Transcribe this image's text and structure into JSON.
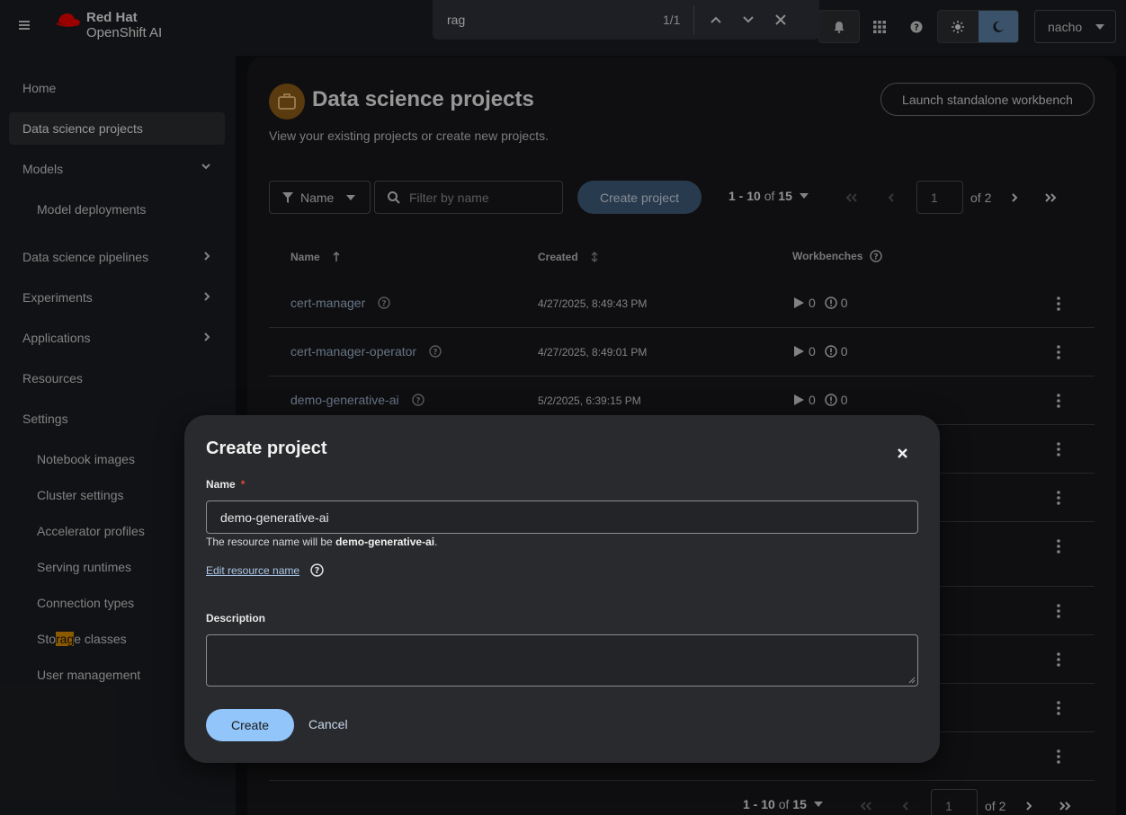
{
  "masthead": {
    "brand": "Red Hat",
    "product": "OpenShift AI",
    "user": "nacho"
  },
  "findbar": {
    "query": "rag",
    "count": "1/1"
  },
  "sidebar": {
    "items": [
      {
        "label": "Home"
      },
      {
        "label": "Data science projects"
      },
      {
        "label": "Models"
      },
      {
        "label": "Model deployments"
      },
      {
        "label": "Data science pipelines"
      },
      {
        "label": "Experiments"
      },
      {
        "label": "Applications"
      },
      {
        "label": "Resources"
      },
      {
        "label": "Settings"
      },
      {
        "label": "Notebook images"
      },
      {
        "label": "Cluster settings"
      },
      {
        "label": "Accelerator profiles"
      },
      {
        "label": "Serving runtimes"
      },
      {
        "label": "Connection types"
      },
      {
        "label": "Storage classes",
        "pre": "Sto",
        "match": "rag",
        "post": "e classes"
      },
      {
        "label": "User management"
      }
    ]
  },
  "page": {
    "title": "Data science projects",
    "subtitle": "View your existing projects or create new projects.",
    "launch_button": "Launch standalone workbench"
  },
  "toolbar": {
    "filter_label": "Name",
    "search_placeholder": "Filter by name",
    "create_button": "Create project",
    "pagination": {
      "range": "1 - 10",
      "of": "of",
      "total": "15",
      "page": "1",
      "of_pages": "of 2"
    }
  },
  "table": {
    "headers": {
      "name": "Name",
      "created": "Created",
      "workbenches": "Workbenches"
    },
    "rows": [
      {
        "name": "cert-manager",
        "created": "4/27/2025, 8:49:43 PM",
        "running": "0",
        "errors": "0"
      },
      {
        "name": "cert-manager-operator",
        "created": "4/27/2025, 8:49:01 PM",
        "running": "0",
        "errors": "0"
      },
      {
        "name": "demo-generative-ai",
        "created": "5/2/2025, 6:39:15 PM",
        "running": "0",
        "errors": "0"
      }
    ]
  },
  "modal": {
    "title": "Create project",
    "name_label": "Name",
    "required_mark": "*",
    "name_value": "demo-generative-ai",
    "helper_prefix": "The resource name will be ",
    "helper_resource": "demo-generative-ai",
    "helper_suffix": ".",
    "edit_link": "Edit resource name",
    "description_label": "Description",
    "create_button": "Create",
    "cancel_button": "Cancel"
  },
  "colors": {
    "accent": "#92c5f9",
    "link": "#9cb3cc",
    "highlight": "#d68a00",
    "project_icon": "#8a5a18"
  }
}
